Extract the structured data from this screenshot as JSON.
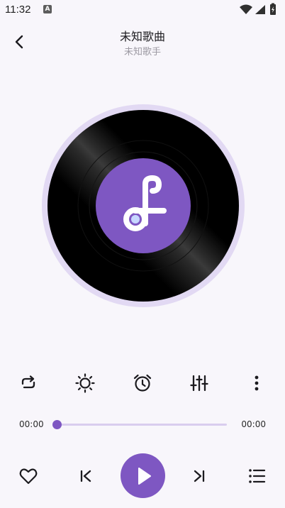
{
  "status_bar": {
    "time": "11:32",
    "notification_badge": "A",
    "icons": [
      "wifi-icon",
      "signal-icon",
      "battery-icon"
    ]
  },
  "header": {
    "title": "未知歌曲",
    "artist": "未知歌手",
    "back_icon": "chevron-left-icon"
  },
  "disc": {
    "logo_icon": "music-note-icon",
    "accent": "#7e57c2",
    "ring_color": "#e2d9f3"
  },
  "controls": [
    "repeat-icon",
    "brightness-icon",
    "alarm-icon",
    "equalizer-icon",
    "more-vert-icon"
  ],
  "progress": {
    "current": "00:00",
    "total": "00:00",
    "fraction": 0
  },
  "bottom_bar": [
    "heart-icon",
    "skip-previous-icon",
    "play-icon",
    "skip-next-icon",
    "playlist-icon"
  ],
  "colors": {
    "accent": "#7e57c2",
    "background": "#f8f6fb"
  }
}
